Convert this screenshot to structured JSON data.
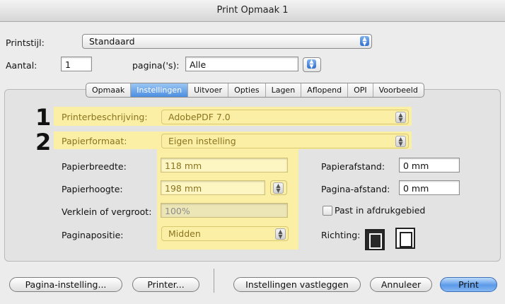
{
  "window": {
    "title": "Print Opmaak 1"
  },
  "top": {
    "style_label": "Printstijl:",
    "style_value": "Standaard",
    "copies_label": "Aantal:",
    "copies_value": "1",
    "pages_label": "pagina('s):",
    "pages_value": "Alle"
  },
  "tabs": [
    "Opmaak",
    "Instellingen",
    "Uitvoer",
    "Opties",
    "Lagen",
    "Aflopend",
    "OPI",
    "Voorbeeld"
  ],
  "active_tab": "Instellingen",
  "annotations": [
    "1",
    "2"
  ],
  "settings": {
    "printer_label": "Printerbeschrijving:",
    "printer_value": "AdobePDF 7.0",
    "paper_label": "Papierformaat:",
    "paper_value": "Eigen instelling",
    "width_label": "Papierbreedte:",
    "width_value": "118 mm",
    "height_label": "Papierhoogte:",
    "height_value": "198 mm",
    "scale_label": "Verklein of vergroot:",
    "scale_value": "100%",
    "position_label": "Paginapositie:",
    "position_value": "Midden",
    "gap_label": "Papierafstand:",
    "gap_value": "0 mm",
    "page_gap_label": "Pagina-afstand:",
    "page_gap_value": "0 mm",
    "fit_label": "Past in afdrukgebied",
    "fit_checked": false,
    "orientation_label": "Richting:"
  },
  "buttons": {
    "page_setup": "Pagina-instelling...",
    "printer": "Printer...",
    "save_settings": "Instellingen vastleggen",
    "cancel": "Annuleer",
    "print": "Print"
  },
  "colors": {
    "highlight": "#fcf0a0",
    "accent": "#4c8ee0"
  }
}
